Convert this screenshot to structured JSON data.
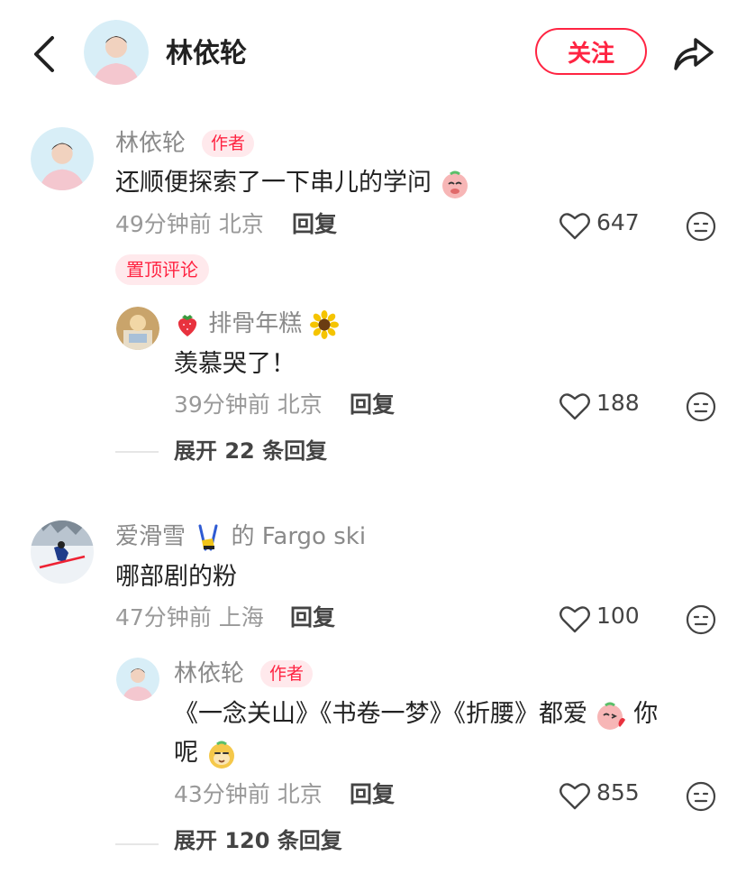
{
  "header": {
    "title": "林依轮",
    "follow": "关注"
  },
  "comments": [
    {
      "name": "林依轮",
      "badge": "作者",
      "text": "还顺便探索了一下串儿的学问",
      "time": "49分钟前",
      "location": "北京",
      "reply": "回复",
      "likes": "647",
      "pinned": "置顶评论",
      "replies": [
        {
          "name": "排骨年糕",
          "text": "羡慕哭了！",
          "time": "39分钟前",
          "location": "北京",
          "reply": "回复",
          "likes": "188"
        }
      ],
      "expand": "展开 22 条回复"
    },
    {
      "name": "爱滑雪",
      "name_suffix": "的 Fargo ski",
      "text": "哪部剧的粉",
      "time": "47分钟前",
      "location": "上海",
      "reply": "回复",
      "likes": "100",
      "replies": [
        {
          "name": "林依轮",
          "badge": "作者",
          "text_line1": "《一念关山》《书卷一梦》《折腰》都爱",
          "text_line1_end": "你",
          "text_line2": "呢",
          "time": "43分钟前",
          "location": "北京",
          "reply": "回复",
          "likes": "855"
        }
      ],
      "expand": "展开 120 条回复"
    }
  ],
  "colors": {
    "accent": "#ff2442",
    "muted": "#999999",
    "badge_bg": "#ffe9ec"
  },
  "icons": [
    "back-icon",
    "share-icon",
    "heart-icon",
    "emoji-reaction-icon"
  ]
}
